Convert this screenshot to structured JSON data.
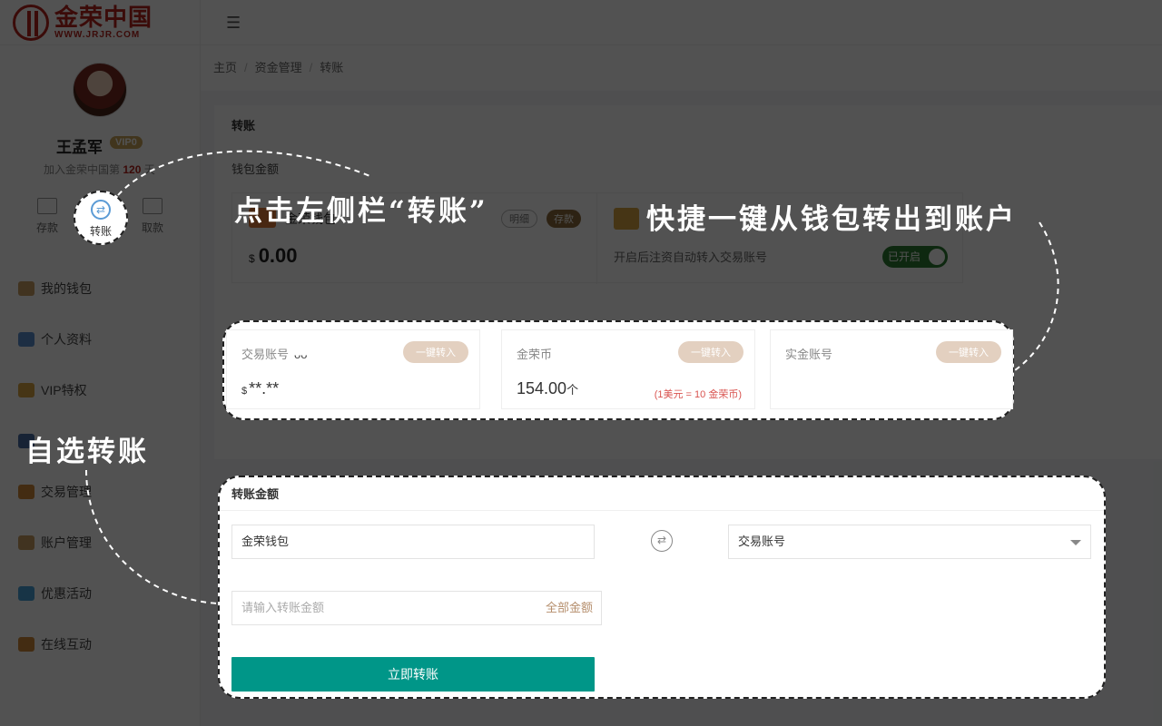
{
  "logo": {
    "cn": "金荣中国",
    "en": "WWW.JRJR.COM"
  },
  "user": {
    "name": "王孟军",
    "vip": "VIP0",
    "joined_prefix": "加入金荣中国第",
    "joined_days": "120",
    "joined_suffix": "天"
  },
  "quick_actions": {
    "deposit": "存款",
    "transfer": "转账",
    "withdraw": "取款"
  },
  "menu": [
    "我的钱包",
    "个人资料",
    "VIP特权",
    "",
    "交易管理",
    "账户管理",
    "优惠活动",
    "在线互动"
  ],
  "breadcrumb": [
    "主页",
    "资金管理",
    "转账"
  ],
  "panel": {
    "title": "转账",
    "wallet_section": "钱包金额"
  },
  "wallet": {
    "name": "金荣钱包",
    "detail": "明细",
    "deposit": "存款",
    "currency": "$",
    "amount": "0.00",
    "auto_text": "开启后注资自动转入交易账号",
    "toggle": "已开启"
  },
  "cards": [
    {
      "title": "交易账号",
      "button": "一键转入",
      "currency": "$",
      "value": "**.**"
    },
    {
      "title": "金荣币",
      "button": "一键转入",
      "value": "154.00",
      "unit": "个",
      "rate": "(1美元 = 10 金荣币)"
    },
    {
      "title": "实金账号",
      "button": "一键转入"
    }
  ],
  "transfer": {
    "title": "转账金额",
    "from": "金荣钱包",
    "to": "交易账号",
    "amount_placeholder": "请输入转账金额",
    "all_amount": "全部金额",
    "submit": "立即转账"
  },
  "annotations": {
    "sidebar": "点击左侧栏“转账”",
    "quick": "快捷一键从钱包转出到账户",
    "custom": "自选转账"
  }
}
